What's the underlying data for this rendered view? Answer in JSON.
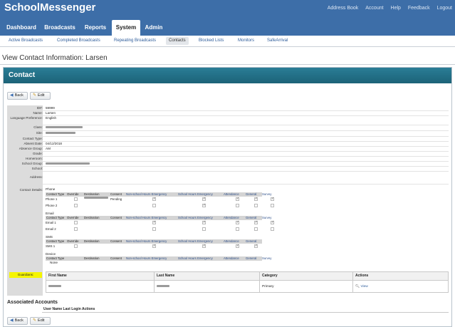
{
  "app": {
    "name": "SchoolMessenger"
  },
  "top_links": [
    "Address Book",
    "Account",
    "Help",
    "Feedback",
    "Logout"
  ],
  "main_tabs": [
    "Dashboard",
    "Broadcasts",
    "Reports",
    "System",
    "Admin"
  ],
  "active_main_tab": "System",
  "sub_tabs": [
    "Active Broadcasts",
    "Completed Broadcasts",
    "Repeating Broadcasts",
    "Contacts",
    "Blocked Lists",
    "Monitors",
    "SafeArrival"
  ],
  "active_sub_tab": "Contacts",
  "page_title": "View Contact Information: Larsen",
  "panel_title": "Contact",
  "buttons": {
    "back": "Back",
    "edit": "Edit"
  },
  "fields": {
    "id": {
      "label": "ID#:",
      "value": "59999"
    },
    "name": {
      "label": "Name:",
      "value": "Larsen"
    },
    "language": {
      "label": "Language Preference:",
      "value": "English"
    },
    "class": {
      "label": "Class:"
    },
    "site": {
      "label": "Site:"
    },
    "contact_type": {
      "label": "Contact Type:"
    },
    "absent_date": {
      "label": "Absent Date:",
      "value": "04/12/2018"
    },
    "absence_group": {
      "label": "Absence Group:",
      "value": "AM"
    },
    "grade": {
      "label": "Grade:"
    },
    "homeroom": {
      "label": "Homeroom:"
    },
    "school_group": {
      "label": "School Group:"
    },
    "school": {
      "label": "School:"
    },
    "address": {
      "label": "Address:"
    },
    "contact_details": {
      "label": "Contact Details:"
    },
    "guardians": {
      "label": "Guardians:"
    }
  },
  "contact_details": {
    "phone": {
      "title": "Phone",
      "columns": [
        "Contact Type",
        "Override",
        "Destination",
        "Consent",
        "Non-school Hours Emergency",
        "School Hours Emergency",
        "Attendance",
        "General",
        "Survey"
      ],
      "rows": [
        {
          "type": "Phone 1",
          "consent": "Pending",
          "checks": [
            false,
            true,
            true,
            true,
            true,
            true
          ]
        },
        {
          "type": "Phone 2",
          "consent": "",
          "checks": [
            false,
            false,
            true,
            false,
            false,
            false
          ]
        }
      ]
    },
    "email": {
      "title": "Email",
      "columns": [
        "Contact Type",
        "Override",
        "Destination",
        "Consent",
        "Non-school Hours Emergency",
        "School Hours Emergency",
        "Attendance",
        "General",
        "Survey"
      ],
      "rows": [
        {
          "type": "Email 1",
          "checks": [
            false,
            true,
            true,
            true,
            true,
            true
          ]
        },
        {
          "type": "Email 2",
          "checks": [
            false,
            false,
            false,
            false,
            false,
            false
          ]
        }
      ]
    },
    "sms": {
      "title": "SMS",
      "columns": [
        "Contact Type",
        "Override",
        "Destination",
        "Consent",
        "Non-school Hours Emergency",
        "School Hours Emergency",
        "Attendance",
        "General"
      ],
      "rows": [
        {
          "type": "SMS 1",
          "checks": [
            false,
            true,
            true,
            true,
            true
          ]
        }
      ]
    },
    "device": {
      "title": "Device",
      "columns": [
        "Contact Type",
        "Destination",
        "Consent",
        "Non-school Hours Emergency",
        "School Hours Emergency",
        "Attendance",
        "General",
        "Survey"
      ],
      "none_text": "None"
    }
  },
  "guardians_table": {
    "columns": [
      "First Name",
      "Last Name",
      "Category",
      "Actions"
    ],
    "row": {
      "category": "Primary",
      "action": "View"
    }
  },
  "associated_accounts": {
    "title": "Associated Accounts",
    "columns": [
      "User Name",
      "Last Login",
      "Actions"
    ]
  },
  "colors": {
    "header_bg": "#3d6ea8",
    "panel_header": "#1c6378",
    "highlight": "#f5f500"
  }
}
